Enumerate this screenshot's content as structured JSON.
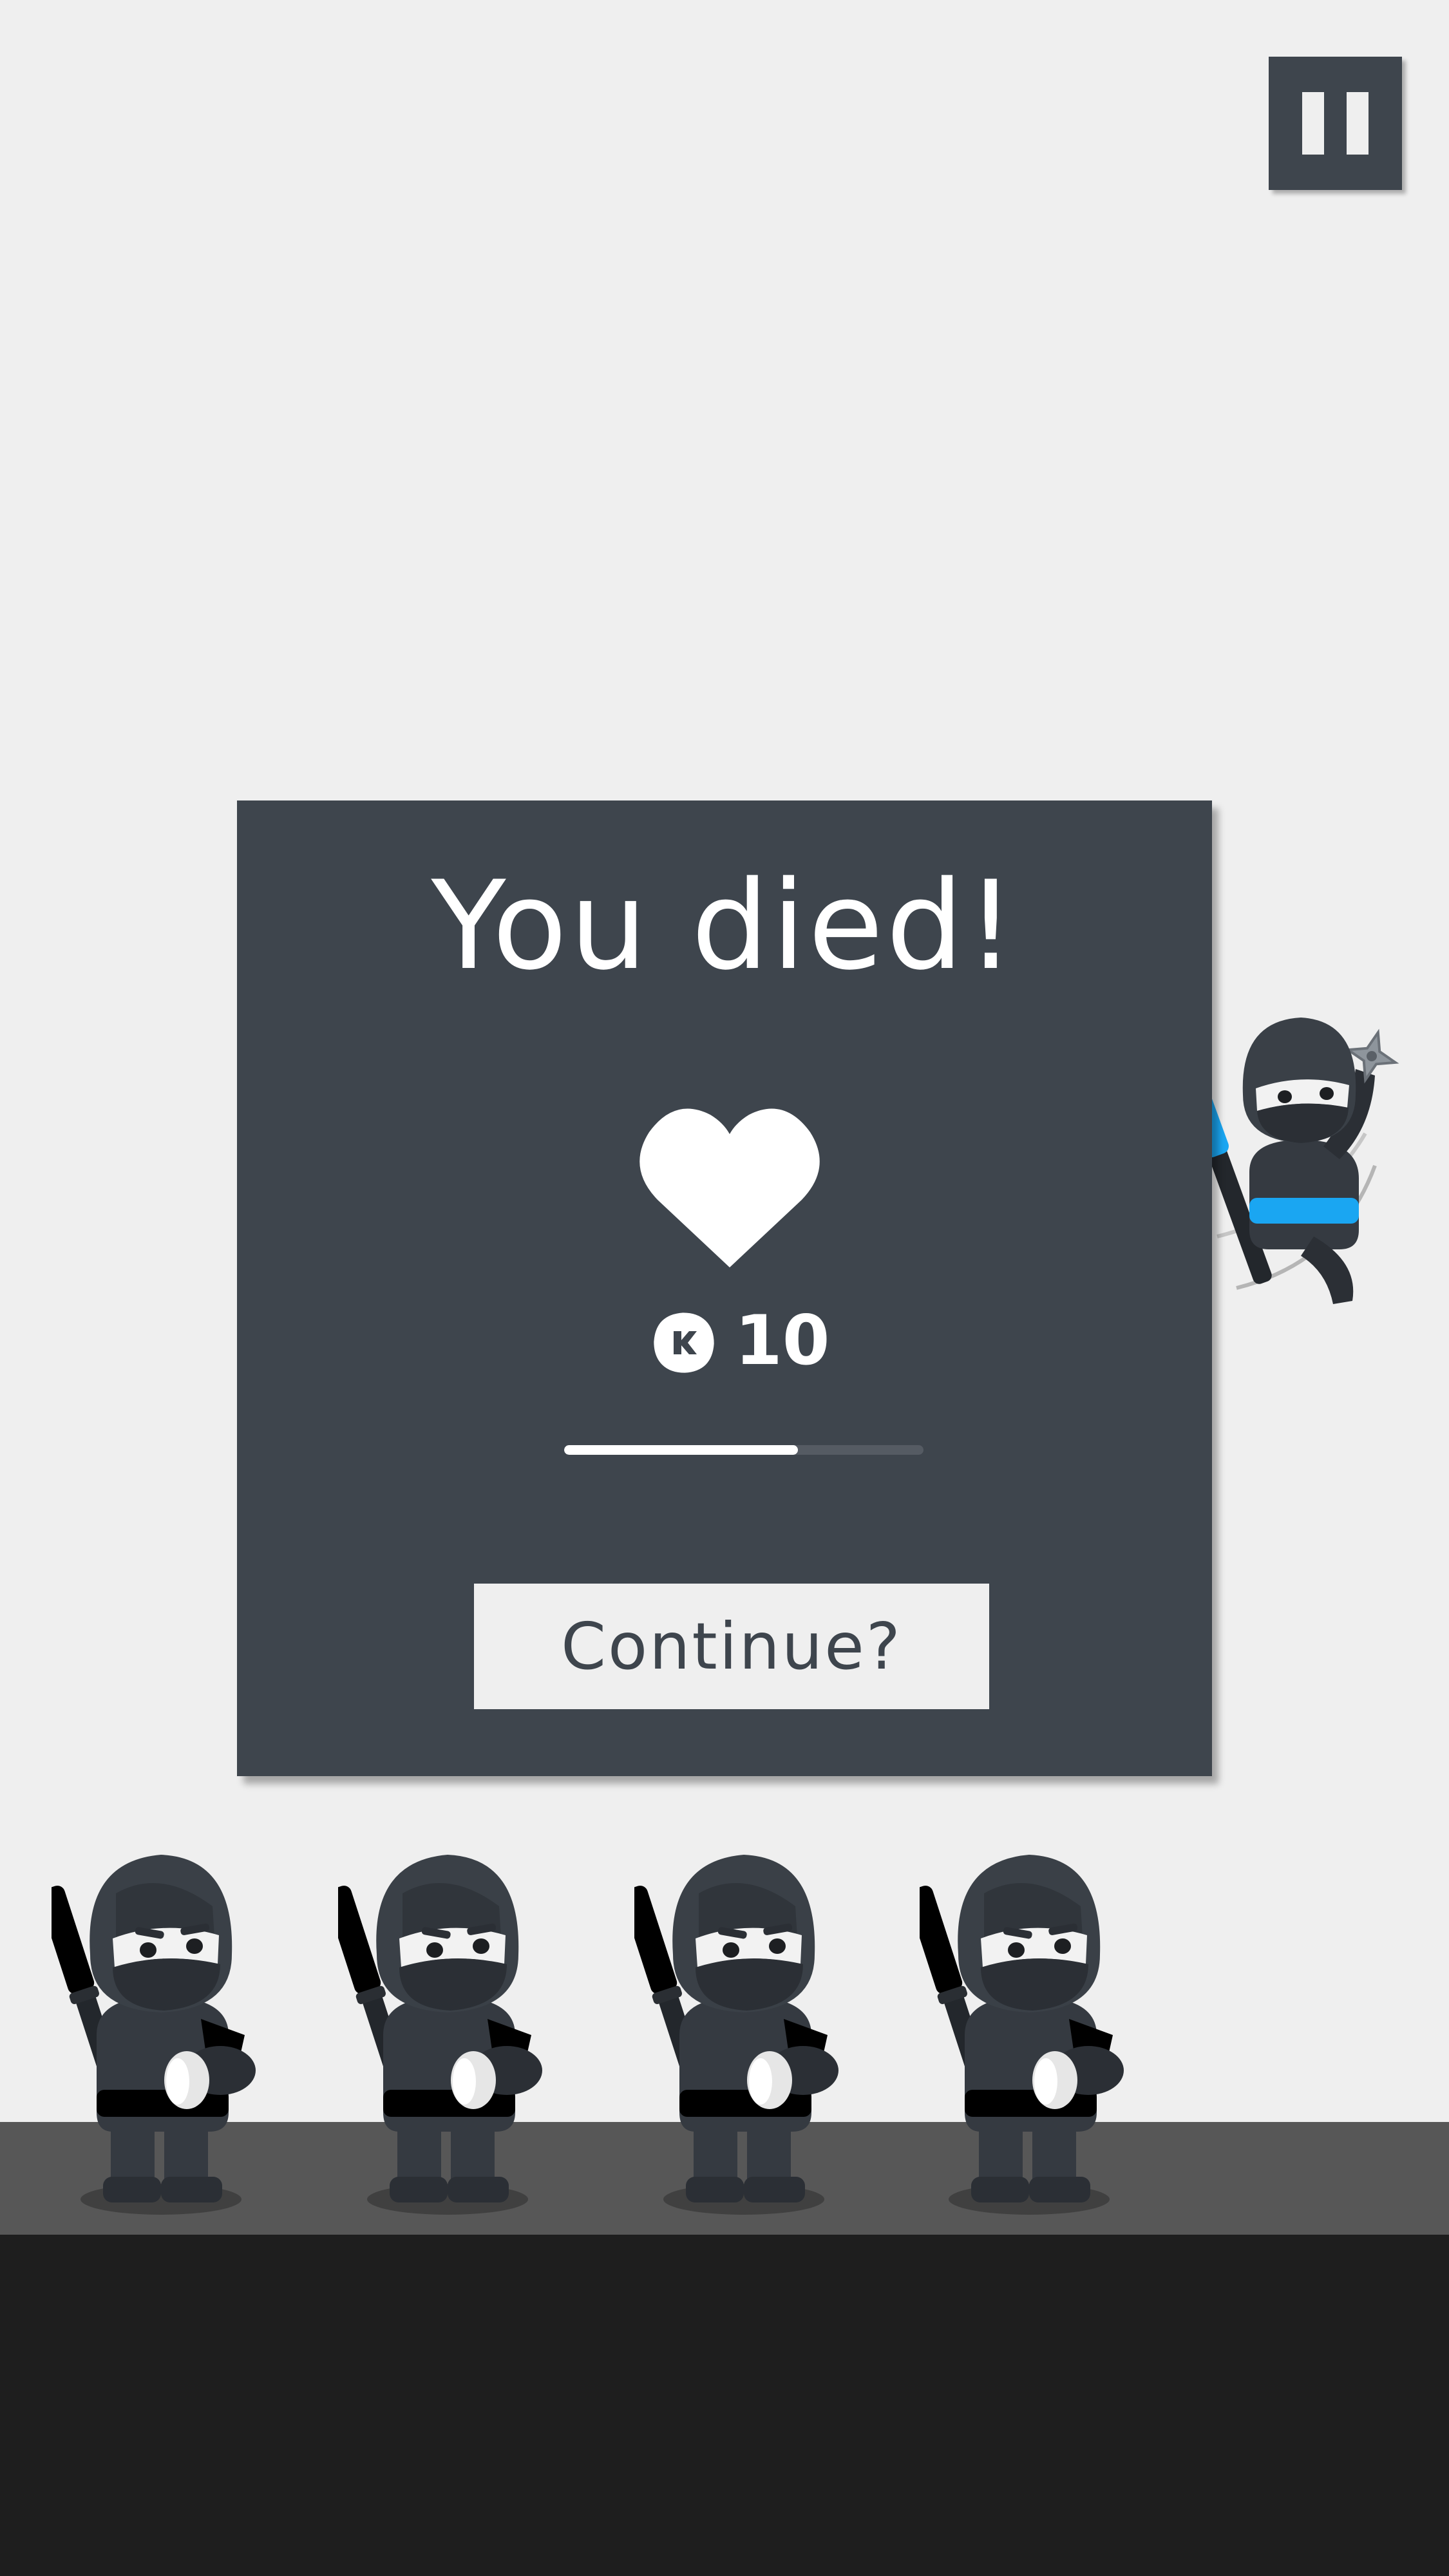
{
  "hud": {
    "pause_icon": "pause-icon"
  },
  "dialog": {
    "title": "You died!",
    "heart_icon": "heart-icon",
    "lives": {
      "coin_icon": "coin-icon",
      "count": "10"
    },
    "timer_progress": 0.65,
    "continue_label": "Continue?"
  },
  "colors": {
    "panel": "#3e454d",
    "background": "#efefef",
    "ground": "#575757",
    "abyss": "#1e1e1e",
    "belts": [
      "#ff3b0a",
      "#ffa415",
      "#ffe518",
      "#8cf21a",
      "#1aa6f2"
    ]
  }
}
